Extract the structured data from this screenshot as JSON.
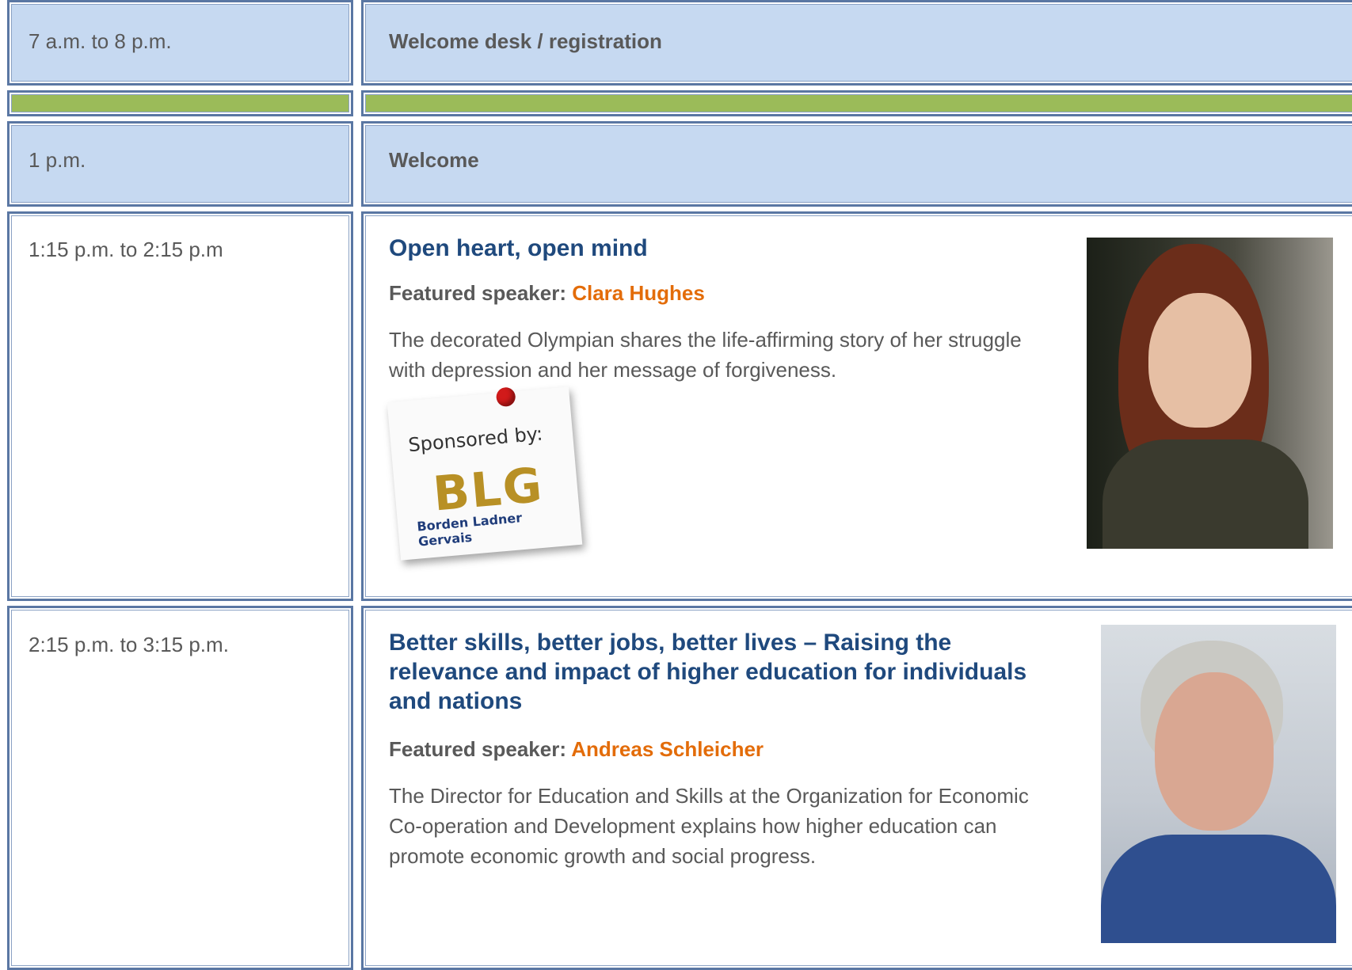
{
  "rows": [
    {
      "time": "7 a.m. to 8 p.m.",
      "label": "Welcome desk / registration"
    },
    {
      "time": "1 p.m.",
      "label": "Welcome"
    },
    {
      "time": "1:15 p.m. to 2:15 p.m",
      "title": "Open heart, open mind",
      "speaker_prefix": "Featured speaker:",
      "speaker_name": "Clara Hughes",
      "description": "The decorated Olympian shares the life-affirming story of her struggle with depression and her message of forgiveness.",
      "sponsor": {
        "label": "Sponsored by:",
        "logo": "BLG",
        "name": "Borden Ladner Gervais"
      }
    },
    {
      "time": "2:15 p.m. to 3:15 p.m.",
      "title": "Better skills, better jobs, better lives – Raising the relevance and impact of higher education for individuals and nations",
      "speaker_prefix": "Featured speaker:",
      "speaker_name": "Andreas Schleicher",
      "description": "The Director for Education and Skills at the Organization for Economic Co-operation and Development explains how higher education can promote economic growth and social progress."
    }
  ],
  "colors": {
    "header_row": "#c6d9f1",
    "separator": "#9bbb59",
    "border": "#5a77a3",
    "title": "#1f497d",
    "speaker_name": "#e36c09"
  }
}
